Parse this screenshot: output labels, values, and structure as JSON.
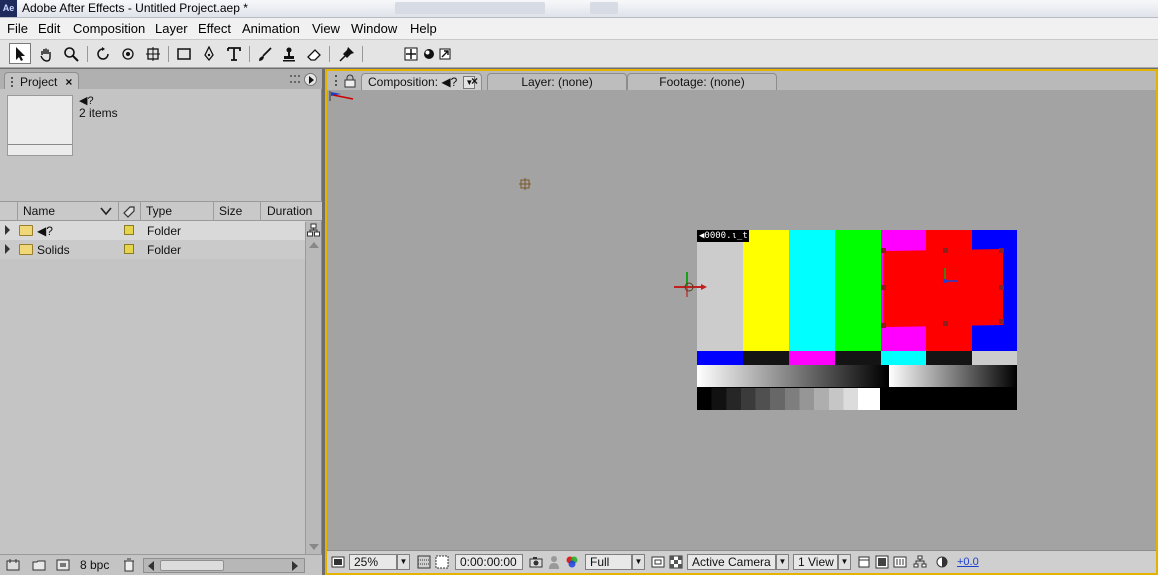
{
  "window": {
    "app_icon": "Ae",
    "title": "Adobe After Effects - Untitled Project.aep *"
  },
  "menu": [
    "File",
    "Edit",
    "Composition",
    "Layer",
    "Effect",
    "Animation",
    "View",
    "Window",
    "Help"
  ],
  "toolbar": {
    "tools": [
      "selection-tool",
      "hand-tool",
      "zoom-tool",
      "rotation-tool",
      "orbit-camera-tool",
      "track-xy-camera-tool",
      "rectangle-mask-tool",
      "pen-tool",
      "type-tool",
      "brush-tool",
      "clone-stamp-tool",
      "eraser-tool",
      "puppet-pin-tool"
    ]
  },
  "project_panel": {
    "tab_label": "Project",
    "tab_close": "×",
    "item_name": "◀?",
    "item_count": "2 items",
    "columns": [
      "Name",
      "Type",
      "Size",
      "Duration"
    ],
    "rows": [
      {
        "name": "◀?",
        "type": "Folder"
      },
      {
        "name": "Solids",
        "type": "Folder"
      }
    ],
    "bit_depth": "8 bpc"
  },
  "comp_panel": {
    "tabs": {
      "composition": "Composition: ◀?",
      "composition_close": "×",
      "layer": "Layer: (none)",
      "footage": "Footage: (none)"
    },
    "timecode_overlay": "◀0000.ι_t",
    "bottom": {
      "zoom": "25%",
      "timecode": "0:00:00:00",
      "resolution": "Full",
      "camera": "Active Camera",
      "views": "1 View",
      "exposure": "+0.0"
    }
  },
  "colors": {
    "panel_highlight": "#e3b300",
    "bars_top": [
      "#cccccc",
      "#ffff00",
      "#00ffff",
      "#00ff00",
      "#ff00ff",
      "#ff0000",
      "#0000ff"
    ],
    "bars_mid": [
      "#0000ff",
      "#141414",
      "#ff00ff",
      "#141414",
      "#00ffff",
      "#141414",
      "#cccccc"
    ]
  }
}
